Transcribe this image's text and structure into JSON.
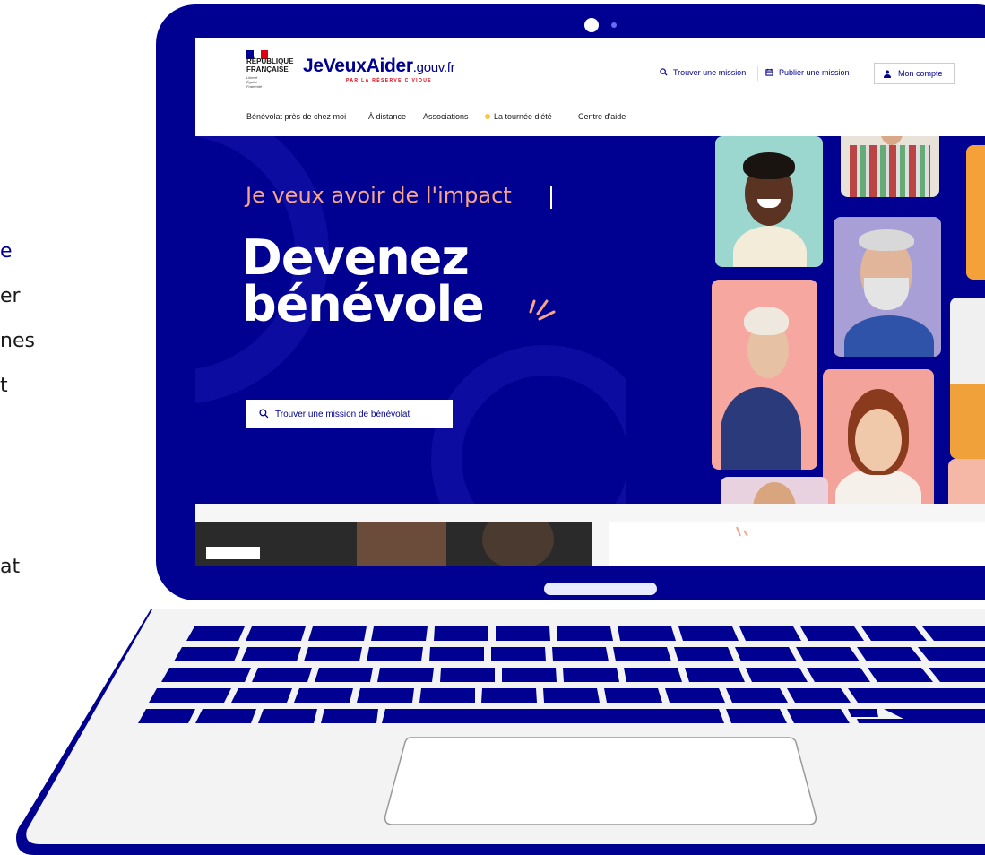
{
  "left_fragments": [
    "e",
    "er",
    "nes",
    "t",
    "at"
  ],
  "colors": {
    "primary": "#000091",
    "accent_salmon": "#f8a48a",
    "marianne_red": "#e1000f",
    "yellow_dot": "#fcc63a"
  },
  "header": {
    "gov_line1": "RÉPUBLIQUE",
    "gov_line2": "FRANÇAISE",
    "gov_motto1": "Liberté",
    "gov_motto2": "Égalité",
    "gov_motto3": "Fraternité",
    "brand_main": "JeVeuxAider",
    "brand_domain": ".gouv.fr",
    "brand_subtitle": "PAR LA RÉSERVE CIVIQUE",
    "find_mission_label": "Trouver une mission",
    "find_mission_icon": "search-icon",
    "publish_mission_label": "Publier une mission",
    "publish_mission_icon": "calendar-icon",
    "account_label": "Mon compte",
    "account_icon": "user-icon"
  },
  "nav": {
    "items": [
      "Bénévolat près de chez moi",
      "À distance",
      "Associations",
      "La tournée d'été",
      "Centre d'aide"
    ]
  },
  "hero": {
    "tagline": "Je veux avoir de l'impact",
    "headline_line1": "Devenez",
    "headline_line2": "bénévole",
    "cta_label": "Trouver une mission de bénévolat",
    "cta_icon": "search-icon"
  }
}
